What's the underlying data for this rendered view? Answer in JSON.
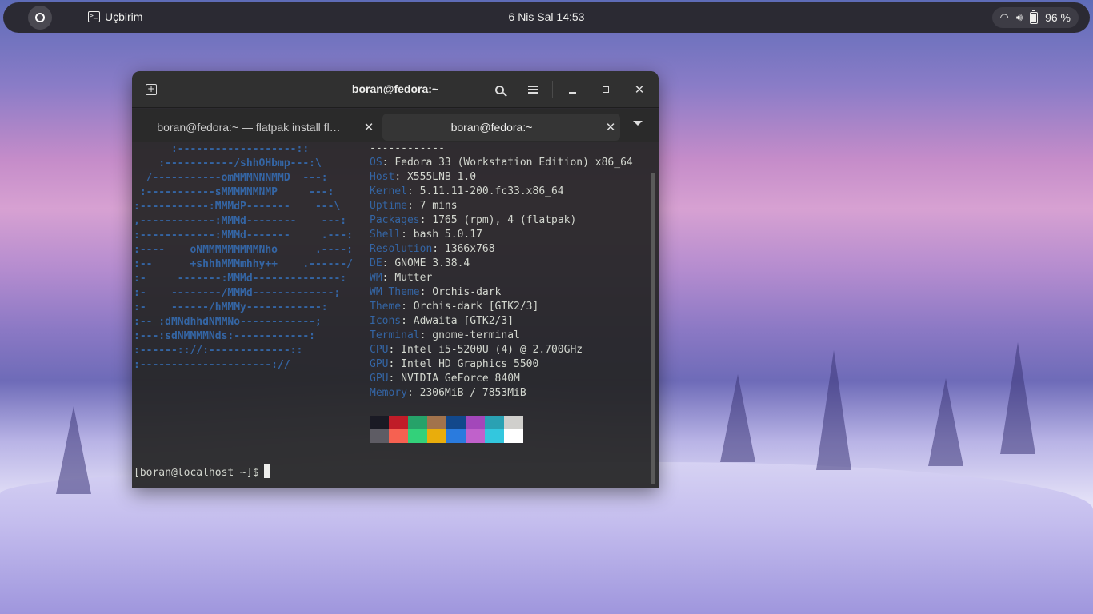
{
  "topbar": {
    "app_name": "Uçbirim",
    "clock": "6 Nis Sal  14:53",
    "battery": "96 %"
  },
  "window": {
    "title": "boran@fedora:~",
    "tabs": [
      {
        "label": "boran@fedora:~ — flatpak install fl…"
      },
      {
        "label": "boran@fedora:~"
      }
    ]
  },
  "terminal": {
    "logo_lines": [
      "      :-------------------::",
      "    :-----------/shhOHbmp---:\\",
      "  /-----------omMMMNNNMMD  ---:",
      " :-----------sMMMMNMNMP     ---:",
      ":-----------:MMMdP-------    ---\\",
      ",------------:MMMd--------    ---:",
      ":------------:MMMd-------     .---:",
      ":----    oNMMMMMMMMMNho      .----:",
      ":--      +shhhMMMmhhy++    .------/",
      ":-     -------:MMMd--------------:",
      ":-    --------/MMMd-------------;",
      ":-    ------/hMMMy------------:",
      ":-- :dMNdhhdNMMNo------------;",
      ":---:sdNMMMMNds:------------:",
      ":------:://:-------------::",
      ":---------------------://"
    ],
    "separator": "------------",
    "info": [
      {
        "key": "OS",
        "value": "Fedora 33 (Workstation Edition) x86_64"
      },
      {
        "key": "Host",
        "value": "X555LNB 1.0"
      },
      {
        "key": "Kernel",
        "value": "5.11.11-200.fc33.x86_64"
      },
      {
        "key": "Uptime",
        "value": "7 mins"
      },
      {
        "key": "Packages",
        "value": "1765 (rpm), 4 (flatpak)"
      },
      {
        "key": "Shell",
        "value": "bash 5.0.17"
      },
      {
        "key": "Resolution",
        "value": "1366x768"
      },
      {
        "key": "DE",
        "value": "GNOME 3.38.4"
      },
      {
        "key": "WM",
        "value": "Mutter"
      },
      {
        "key": "WM Theme",
        "value": "Orchis-dark"
      },
      {
        "key": "Theme",
        "value": "Orchis-dark [GTK2/3]"
      },
      {
        "key": "Icons",
        "value": "Adwaita [GTK2/3]"
      },
      {
        "key": "Terminal",
        "value": "gnome-terminal"
      },
      {
        "key": "CPU",
        "value": "Intel i5-5200U (4) @ 2.700GHz"
      },
      {
        "key": "GPU",
        "value": "Intel HD Graphics 5500"
      },
      {
        "key": "GPU",
        "value": "NVIDIA GeForce 840M"
      },
      {
        "key": "Memory",
        "value": "2306MiB / 7853MiB"
      }
    ],
    "palette": [
      "#1a1a24",
      "#c01c28",
      "#26a269",
      "#a2734c",
      "#12488b",
      "#a347ba",
      "#2aa1b3",
      "#d0cfcc",
      "#5e5c64",
      "#f66151",
      "#33d17a",
      "#e9ad0c",
      "#2a7bde",
      "#c061cb",
      "#33c7de",
      "#ffffff"
    ],
    "prompt": "[boran@localhost ~]$"
  },
  "colors": {
    "logo_blue": "#3465a4",
    "topbar_bg": "#2b2a33",
    "window_bg": "#252525"
  }
}
